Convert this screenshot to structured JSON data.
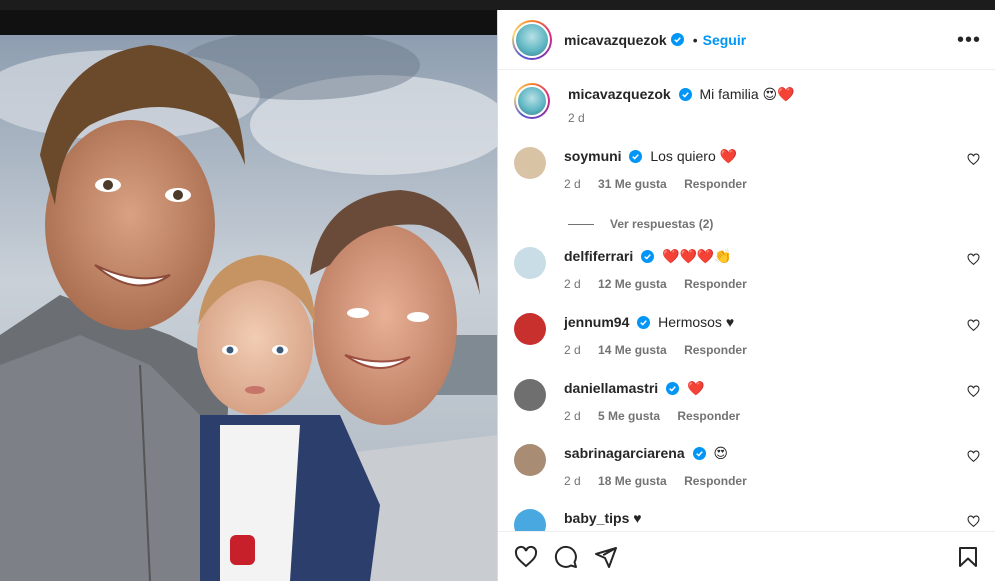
{
  "post": {
    "author": "micavazquezok",
    "follow_label": "Seguir",
    "separator": "•",
    "more_label": "•••",
    "caption": {
      "username": "micavazquezok",
      "text": "Mi familia 😍❤️",
      "time": "2 d"
    }
  },
  "comments": [
    {
      "username": "soymuni",
      "text": "Los quiero ❤️",
      "time": "2 d",
      "likes": "31 Me gusta",
      "reply": "Responder",
      "avatar_color": "#d8c3a5"
    },
    {
      "username": "delfiferrari",
      "text": "❤️❤️❤️👏",
      "time": "2 d",
      "likes": "12 Me gusta",
      "reply": "Responder",
      "avatar_color": "#c9dde6"
    },
    {
      "username": "jennum94",
      "text": "Hermosos ♥",
      "time": "2 d",
      "likes": "14 Me gusta",
      "reply": "Responder",
      "avatar_color": "#c8302e"
    },
    {
      "username": "daniellamastri",
      "text": "❤️",
      "time": "2 d",
      "likes": "5 Me gusta",
      "reply": "Responder",
      "avatar_color": "#6f6f6f"
    },
    {
      "username": "sabrinagarciarena",
      "text": "😍",
      "time": "2 d",
      "likes": "18 Me gusta",
      "reply": "Responder",
      "avatar_color": "#a98c74"
    },
    {
      "username": "baby_tips",
      "text": "♥",
      "time": "",
      "likes": "",
      "reply": "",
      "avatar_color": "#4aa8e0"
    }
  ],
  "view_replies": "Ver respuestas (2)",
  "colors": {
    "accent": "#0095f6",
    "verified": "#0095f6",
    "heart": "#ed1c24"
  },
  "icons": [
    "heart-icon",
    "comment-icon",
    "share-icon",
    "bookmark-icon",
    "more-icon",
    "verified-icon"
  ]
}
